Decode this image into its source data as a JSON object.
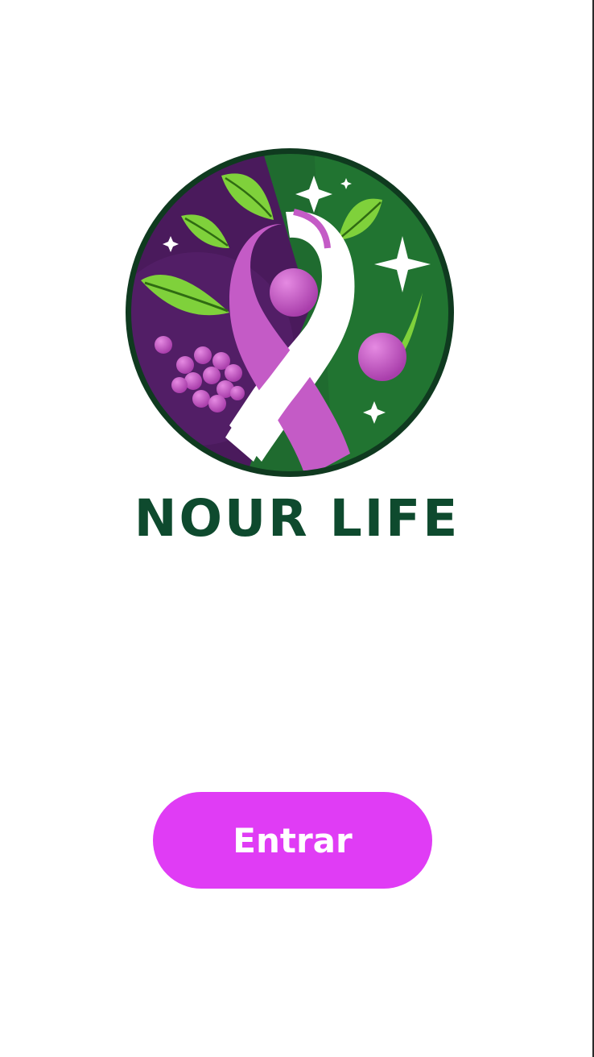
{
  "logo": {
    "icon": "nour-life-ribbon-logo",
    "colors": {
      "purple": "#4b1a5e",
      "green": "#1e6b2c",
      "dark_green": "#0e4a2e",
      "berry": "#c45bc6",
      "leaf": "#7fd13b",
      "ribbon": "#ffffff"
    }
  },
  "brand": {
    "name": "NOUR LIFE",
    "color": "#0e4a2e"
  },
  "actions": {
    "enter_label": "Entrar",
    "enter_color": "#e03cf5"
  }
}
